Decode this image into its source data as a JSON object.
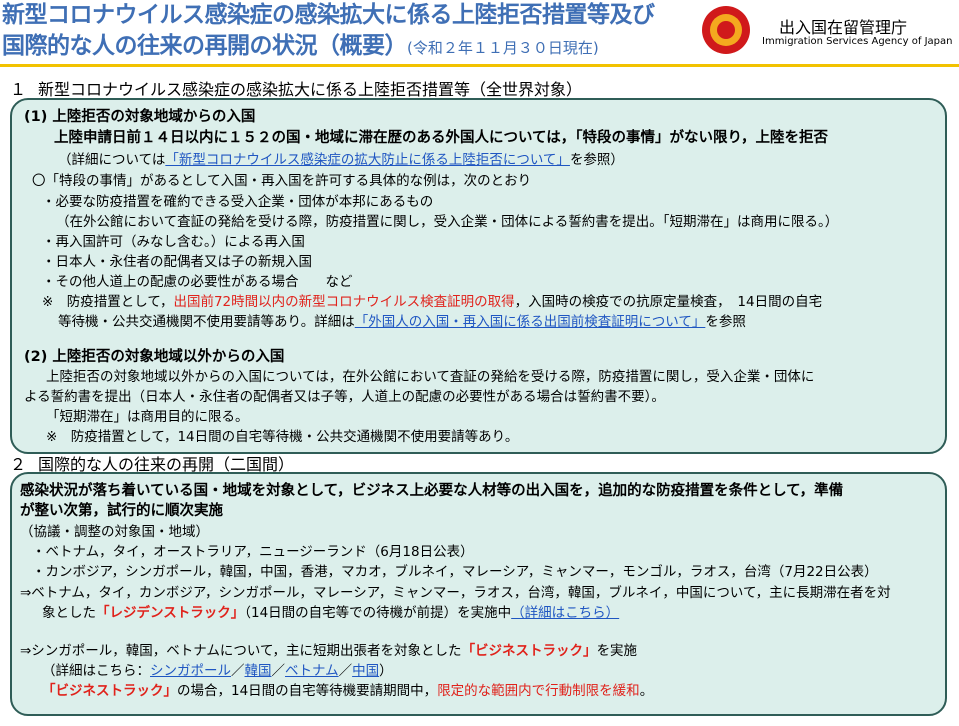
{
  "header": {
    "title_line1": "新型コロナウイルス感染症の感染拡大に係る上陸拒否措置等及び",
    "title_line2": "国際的な人の往来の再開の状況（概要）",
    "title_date": "(令和２年１１月３０日現在)",
    "agency_jp": "出入国在留管理庁",
    "agency_en": "Immigration Services Agency of Japan"
  },
  "section1": {
    "number": "１",
    "heading": "新型コロナウイルス感染症の感染拡大に係る上陸拒否措置等（全世界対象）",
    "p1": {
      "heading": "(1)  上陸拒否の対象地域からの入国",
      "lead": "上陸申請日前１４日以内に１５２の国・地域に滞在歴のある外国人については，「特段の事情」がない限り，上陸を拒否",
      "ref_pre": "（詳細については",
      "ref_link": "「新型コロナウイルス感染症の拡大防止に係る上陸拒否について」",
      "ref_post": "を参照）",
      "examples_intro": "〇「特段の事情」があるとして入国・再入国を許可する具体的な例は，次のとおり",
      "ex1": "・必要な防疫措置を確約できる受入企業・団体が本邦にあるもの",
      "ex1_note": "（在外公館において査証の発給を受ける際，防疫措置に関し，受入企業・団体による誓約書を提出。「短期滞在」は商用に限る。）",
      "ex2": "・再入国許可（みなし含む。）による再入国",
      "ex3": "・日本人・永住者の配偶者又は子の新規入国",
      "ex4": "・その他人道上の配慮の必要性がある場合　　など",
      "note_pre": "※　防疫措置として，",
      "note_red": "出国前72時間以内の新型コロナウイルス検査証明の取得",
      "note_post": "，入国時の検疫での抗原定量検査，　14日間の自宅",
      "note2_pre": "等待機・公共交通機関不使用要請等あり。詳細は",
      "note2_link": "「外国人の入国・再入国に係る出国前検査証明について」",
      "note2_post": "を参照"
    },
    "p2": {
      "heading": "(2)  上陸拒否の対象地域以外からの入国",
      "line1": "上陸拒否の対象地域以外からの入国については，在外公館において査証の発給を受ける際，防疫措置に関し，受入企業・団体に",
      "line2": "よる誓約書を提出（日本人・永住者の配偶者又は子等，人道上の配慮の必要性がある場合は誓約書不要）。",
      "line3": "「短期滞在」は商用目的に限る。",
      "line4": "※　防疫措置として，14日間の自宅等待機・公共交通機関不使用要請等あり。"
    }
  },
  "section2": {
    "number": "２",
    "heading": "国際的な人の往来の再開（二国間）",
    "lead1": "感染状況が落ち着いている国・地域を対象として，ビジネス上必要な人材等の出入国を，追加的な防疫措置を条件として，準備",
    "lead2": "が整い次第，試行的に順次実施",
    "targets_label": "（協議・調整の対象国・地域）",
    "targets1": "・ベトナム，タイ，オーストラリア，ニュージーランド（6月18日公表）",
    "targets2": "・カンボジア，シンガポール，韓国，中国，香港，マカオ，ブルネイ，マレーシア，ミャンマー，モンゴル，ラオス，台湾（7月22日公表）",
    "res1": "⇒ベトナム，タイ，カンボジア，シンガポール，マレーシア，ミャンマー，ラオス，台湾，韓国，ブルネイ，中国について，主に長期滞在者を対",
    "res2_pre": "象とした",
    "res2_red": "「レジデンストラック」",
    "res2_mid": "（14日間の自宅等での待機が前提）を実施中",
    "res2_link": "（詳細はこちら）",
    "biz1_pre": "⇒シンガポール，韓国，ベトナムについて，主に短期出張者を対象とした",
    "biz1_red": "「ビジネストラック」",
    "biz1_post": "を実施",
    "biz2_pre": "（詳細はこちら：",
    "biz2_l1": "シンガポール",
    "biz2_s1": "／",
    "biz2_l2": "韓国",
    "biz2_s2": "／",
    "biz2_l3": "ベトナム",
    "biz2_s3": "／",
    "biz2_l4": "中国",
    "biz2_post": "）",
    "biz3_red": "「ビジネストラック」",
    "biz3_mid": "の場合，14日間の自宅等待機要請期間中，",
    "biz3_red2": "限定的な範囲内で行動制限を緩和",
    "biz3_post": "。"
  },
  "colors": {
    "title": "#3f6fb5",
    "box_bg": "#dcefeb",
    "box_border": "#2f5d57",
    "accent_red": "#e0231c",
    "link": "#1f56c2",
    "rule": "#f2c200"
  }
}
